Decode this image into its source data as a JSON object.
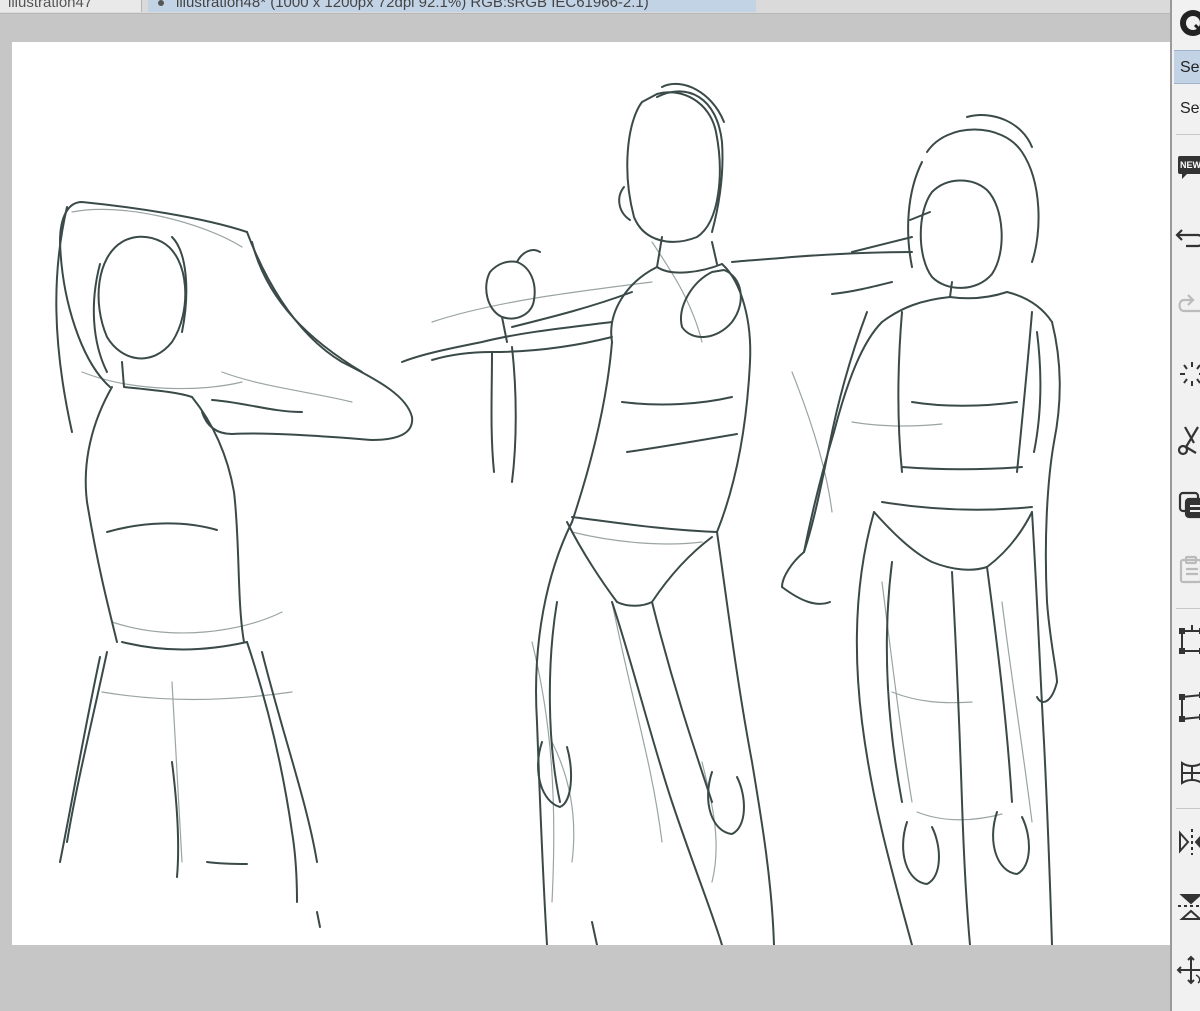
{
  "tabs": [
    {
      "label": "illustration47",
      "active": false
    },
    {
      "label": "illustration48* (1000 x 1200px 72dpi 92.1%) RGB:sRGB IEC61966-2.1)",
      "active": true
    }
  ],
  "command_bar": {
    "set_button_1": "Set",
    "set_button_2": "Set",
    "new_badge": "NEW"
  },
  "colors": {
    "stroke": "#3a4a48",
    "stroke_light": "#9aa5a3",
    "workspace": "#c6c6c6",
    "canvas": "#ffffff",
    "tab_active": "#c3d3e6"
  }
}
